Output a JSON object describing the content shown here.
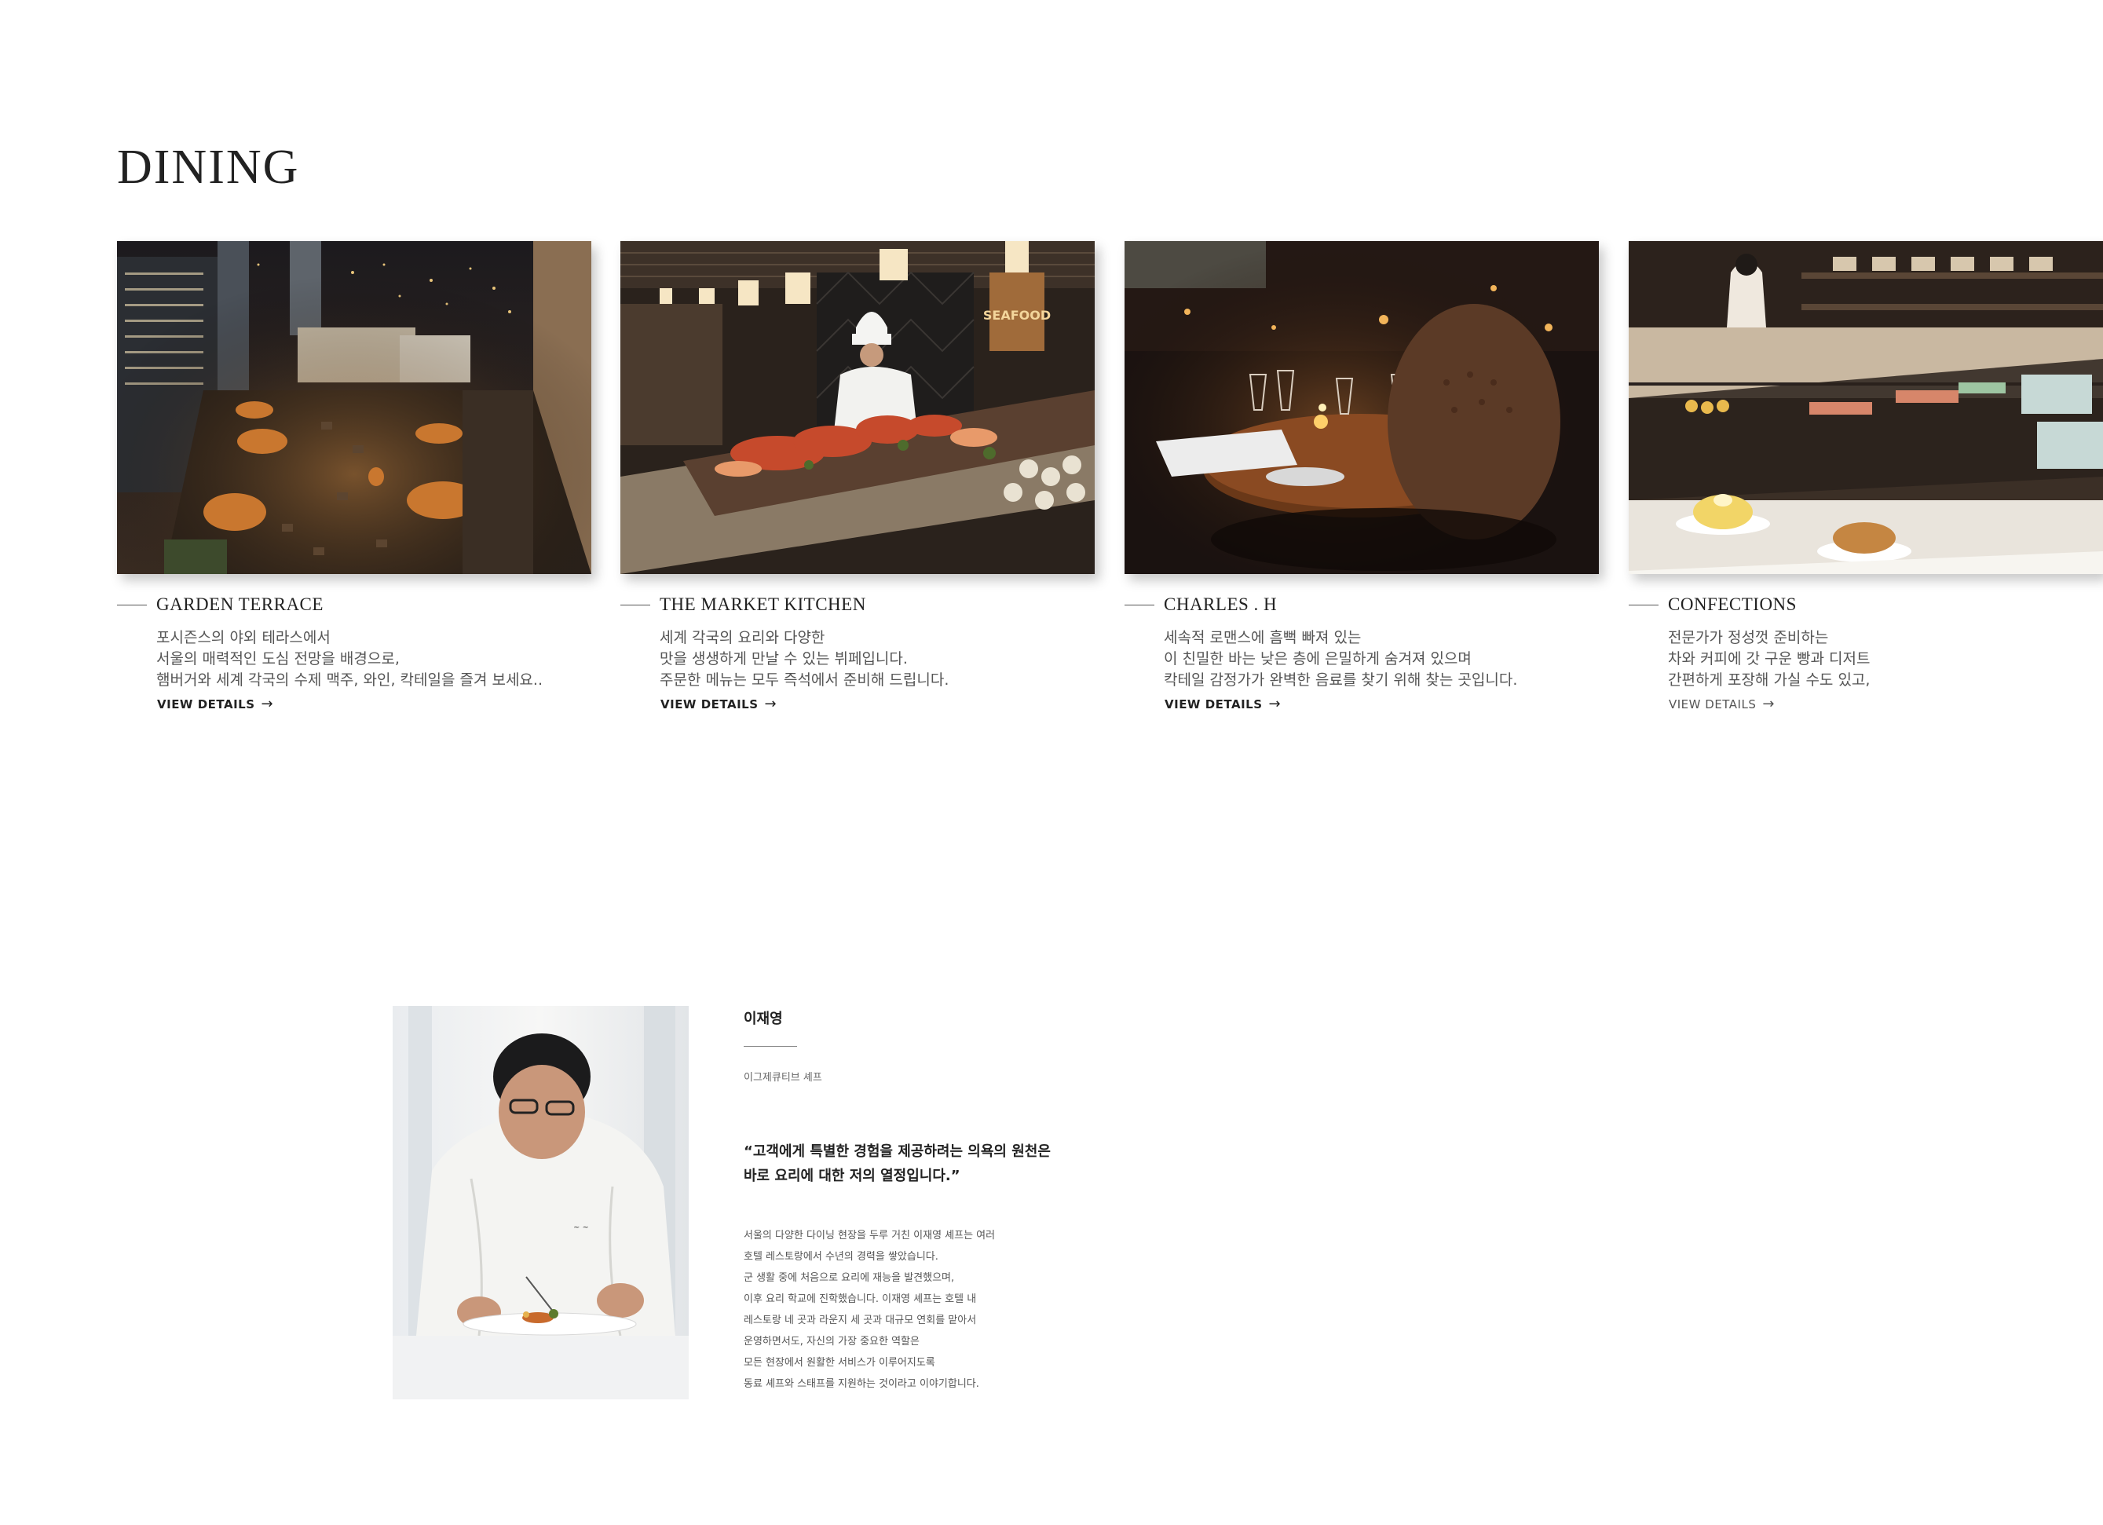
{
  "section": {
    "title": "DINING"
  },
  "cards": [
    {
      "name": "GARDEN TERRACE",
      "desc": [
        "포시즌스의 야외 테라스에서",
        "서울의 매력적인 도심 전망을 배경으로,",
        "햄버거와 세계 각국의 수제 맥주, 와인, 칵테일을 즐겨 보세요.."
      ],
      "details_label": "VIEW DETAILS",
      "photo_icon": "rooftop-terrace-photo"
    },
    {
      "name": "THE MARKET KITCHEN",
      "desc": [
        "세계 각국의 요리와 다양한",
        "맛을 생생하게 만날 수 있는 뷔페입니다.",
        "주문한 메뉴는 모두 즉석에서 준비해 드립니다."
      ],
      "details_label": "VIEW DETAILS",
      "photo_icon": "buffet-chef-photo",
      "photo_sign": "SEAFOOD"
    },
    {
      "name": "CHARLES . H",
      "desc": [
        "세속적 로맨스에 흠뻑 빠져 있는",
        "이 친밀한 바는 낮은 층에 은밀하게 숨겨져 있으며",
        "칵테일 감정가가 완벽한 음료를 찾기 위해 찾는 곳입니다."
      ],
      "details_label": "VIEW DETAILS",
      "photo_icon": "candlelit-bar-photo"
    },
    {
      "name": "CONFECTIONS",
      "desc": [
        "전문가가 정성껏 준비하는",
        "차와 커피에 갓 구운 빵과 디저트",
        "간편하게 포장해 가실 수도 있고,"
      ],
      "details_label": "VIEW DETAILS",
      "photo_icon": "pastry-case-photo"
    }
  ],
  "chef": {
    "name": "이재영",
    "role": "이그제큐티브 셰프",
    "quote": [
      "“고객에게 특별한 경험을 제공하려는 의욕의 원천은",
      "바로 요리에 대한 저의 열정입니다.”"
    ],
    "bio": [
      "서울의 다양한 다이닝 현장을 두루 거친 이재영 셰프는 여러",
      "호텔 레스토랑에서 수년의 경력을 쌓았습니다.",
      "군 생활 중에 처음으로 요리에 재능을 발견했으며,",
      "이후 요리 학교에 진학했습니다. 이재영 셰프는 호텔 내",
      "레스토랑 네 곳과 라운지 세 곳과 대규모 연회를 맡아서",
      "운영하면서도, 자신의 가장 중요한 역할은",
      "모든 현장에서 원활한 서비스가 이루어지도록",
      "동료 셰프와 스태프를 지원하는 것이라고 이야기합니다."
    ],
    "photo_icon": "chef-plating-photo"
  }
}
